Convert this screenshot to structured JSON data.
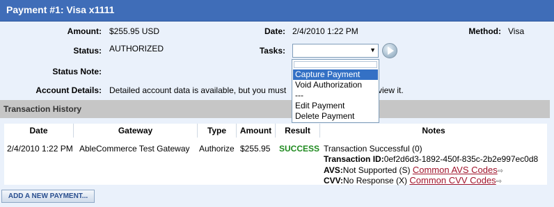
{
  "header": {
    "title": "Payment #1: Visa x1111"
  },
  "fields": {
    "amount_label": "Amount:",
    "amount": "$255.95 USD",
    "date_label": "Date:",
    "date": "2/4/2010 1:22 PM",
    "method_label": "Method:",
    "method": "Visa",
    "status_label": "Status:",
    "status": "AUTHORIZED",
    "tasks_label": "Tasks:",
    "status_note_label": "Status Note:",
    "account_label": "Account Details:",
    "account_text_a": "Detailed account data is available, but you must",
    "account_text_b": "view it."
  },
  "tasks_dropdown": {
    "selected": "",
    "options": [
      "Capture Payment",
      "Void Authorization",
      "---",
      "Edit Payment",
      "Delete Payment"
    ],
    "highlighted_index": 0
  },
  "section": {
    "title": "Transaction History"
  },
  "table": {
    "headers": [
      "Date",
      "Gateway",
      "Type",
      "Amount",
      "Result",
      "Notes"
    ],
    "rows": [
      {
        "date": "2/4/2010 1:22 PM",
        "gateway": "AbleCommerce Test Gateway",
        "type": "Authorize",
        "amount": "$255.95",
        "result": "SUCCESS",
        "notes": {
          "line1": "Transaction Successful (0)",
          "txn_label": "Transaction ID:",
          "txn_value": "0ef2d6d3-1892-450f-835c-2b2e997ec0d8",
          "avs_label": "AVS:",
          "avs_value": "Not Supported (S)",
          "avs_link": "Common AVS Codes",
          "cvv_label": "CVV:",
          "cvv_value": "No Response (X)",
          "cvv_link": "Common CVV Codes"
        }
      }
    ]
  },
  "actions": {
    "add_payment": "ADD A NEW PAYMENT..."
  },
  "colors": {
    "header_bg": "#3f6db8",
    "success": "#1f8a1f",
    "link": "#a0142c",
    "selection": "#3471c5"
  }
}
